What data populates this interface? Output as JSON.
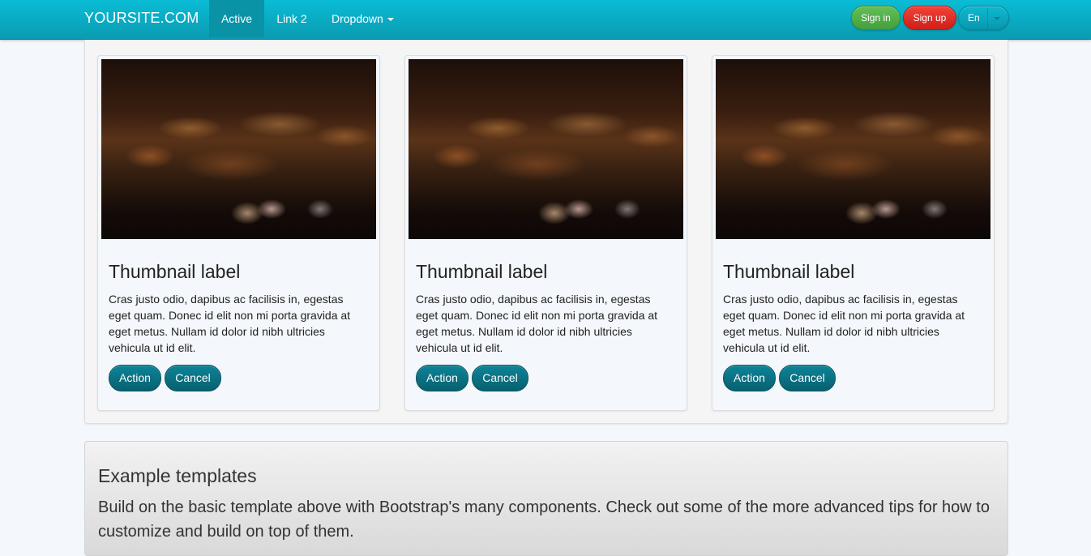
{
  "navbar": {
    "brand": "YOURSITE.COM",
    "items": [
      {
        "label": "Active"
      },
      {
        "label": "Link 2"
      },
      {
        "label": "Dropdown"
      }
    ],
    "sign_in": "Sign in",
    "sign_up": "Sign up",
    "language": "En"
  },
  "thumbnails": [
    {
      "title": "Thumbnail label",
      "text": "Cras justo odio, dapibus ac facilisis in, egestas eget quam. Donec id elit non mi porta gravida at eget metus. Nullam id dolor id nibh ultricies vehicula ut id elit.",
      "action_label": "Action",
      "cancel_label": "Cancel"
    },
    {
      "title": "Thumbnail label",
      "text": "Cras justo odio, dapibus ac facilisis in, egestas eget quam. Donec id elit non mi porta gravida at eget metus. Nullam id dolor id nibh ultricies vehicula ut id elit.",
      "action_label": "Action",
      "cancel_label": "Cancel"
    },
    {
      "title": "Thumbnail label",
      "text": "Cras justo odio, dapibus ac facilisis in, egestas eget quam. Donec id elit non mi porta gravida at eget metus. Nullam id dolor id nibh ultricies vehicula ut id elit.",
      "action_label": "Action",
      "cancel_label": "Cancel"
    }
  ],
  "jumbotron": {
    "title": "Example templates",
    "text": "Build on the basic template above with Bootstrap's many components. Check out some of the more advanced tips for how to customize and build on top of them."
  },
  "colors": {
    "navbar": "#0abcd6",
    "sign_in": "#4caf44",
    "sign_up": "#e0281f",
    "primary_button": "#0a7386"
  }
}
